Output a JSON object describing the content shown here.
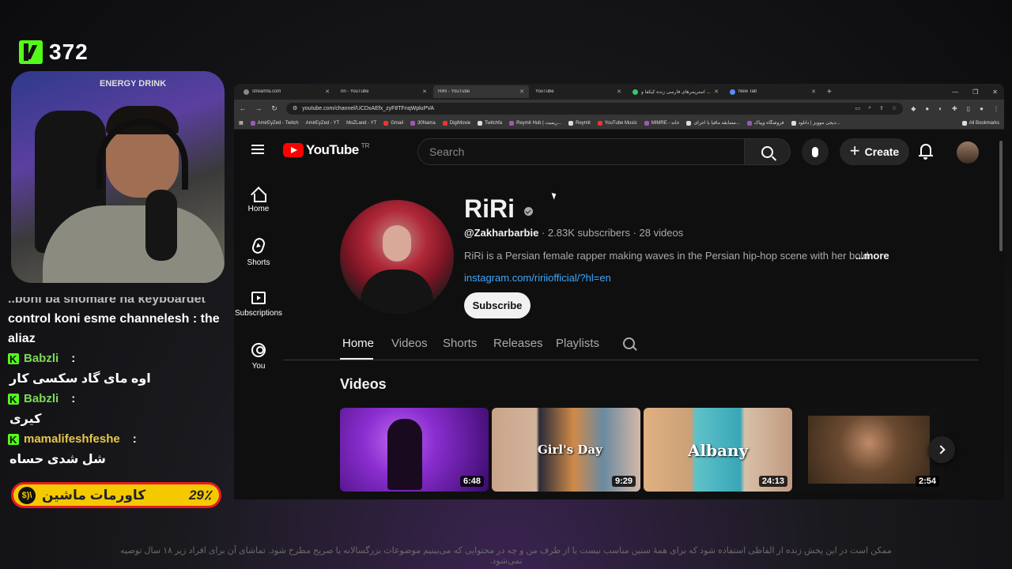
{
  "stream": {
    "viewer_count": "372",
    "webcam_sign": "ENERGY DRINK",
    "chat": [
      {
        "type": "text",
        "text": "..boni ba shomare ha keyboardet"
      },
      {
        "type": "text",
        "text": "control koni esme channelesh : the aliaz"
      },
      {
        "type": "user",
        "name": "Babzli",
        "color": "#7ed957",
        "message": "اوه مای گاد سکسی کار"
      },
      {
        "type": "user",
        "name": "Babzli",
        "color": "#7ed957",
        "message": "کیری"
      },
      {
        "type": "user",
        "name": "mamalifeshfeshe",
        "color": "#e6c84a",
        "message": "شل شدی حساه"
      }
    ],
    "goal": {
      "percent": "29٪",
      "label": "کاورمات ماشین",
      "icon_text": "$)\\"
    },
    "disclaimer": "ممکن است در این پخش زنده از الفاظی استفاده شود که برای همهٔ سنین مناسب نیست یا از طرف من و چه در محتوایی که می‌بینیم موضوعات بزرگسالانه یا صریح مطرح شود. تماشای آن برای افراد زیر ۱۸ سال توصیه نمی‌شود."
  },
  "browser": {
    "tabs": [
      {
        "label": "streamfa.com",
        "favicon": "globe-icon",
        "active": false
      },
      {
        "label": "riri - YouTube",
        "favicon": "youtube-icon",
        "active": false
      },
      {
        "label": "RiRi - YouTube",
        "favicon": "youtube-icon",
        "active": true
      },
      {
        "label": "YouTube",
        "favicon": "youtube-icon",
        "active": false
      },
      {
        "label": "استریمرهای فارسی زنده کیکفا و ...",
        "favicon": "shield-icon",
        "active": false
      },
      {
        "label": "New Tab",
        "favicon": "chrome-icon",
        "active": false
      }
    ],
    "url": "youtube.com/channel/UCDxAEfx_zyF8TFnqWpluPVA",
    "bookmarks": [
      "AmirEyZed - Twitch",
      "AmirEyZed - YT",
      "MoZLand - YT",
      "Gmail",
      "30Nama",
      "DigiMovie",
      "Twitchfa",
      "Reymit Hub | ریمیت...",
      "Reymit",
      "YouTube Music",
      "MIMRE - خانه",
      "مسابقه مافیا با اجرای...",
      "فروشگاه وپیاک",
      "دیجی موویز | دانلود...",
      "All Bookmarks"
    ]
  },
  "youtube": {
    "logo_text": "YouTube",
    "country_code": "TR",
    "search_placeholder": "Search",
    "create_label": "Create",
    "sidebar": [
      {
        "label": "Home",
        "icon": "home-icon"
      },
      {
        "label": "Shorts",
        "icon": "shorts-icon"
      },
      {
        "label": "Subscriptions",
        "icon": "subscriptions-icon"
      },
      {
        "label": "You",
        "icon": "you-icon"
      }
    ],
    "channel": {
      "name": "RiRi",
      "handle": "@Zakharbarbie",
      "subscribers": "2.83K subscribers",
      "videos_count": "28 videos",
      "description": "RiRi is a Persian female rapper making waves in the Persian hip-hop scene with her bold",
      "more_label": "...more",
      "link": "instagram.com/ririiofficial/?hl=en",
      "subscribe_label": "Subscribe"
    },
    "channel_tabs": [
      "Home",
      "Videos",
      "Shorts",
      "Releases",
      "Playlists"
    ],
    "section_title": "Videos",
    "videos": [
      {
        "duration": "6:48",
        "overlay_text": ""
      },
      {
        "duration": "9:29",
        "overlay_text": "Girl's Day"
      },
      {
        "duration": "24:13",
        "overlay_text": "Albany"
      },
      {
        "duration": "2:54",
        "overlay_text": ""
      }
    ]
  }
}
